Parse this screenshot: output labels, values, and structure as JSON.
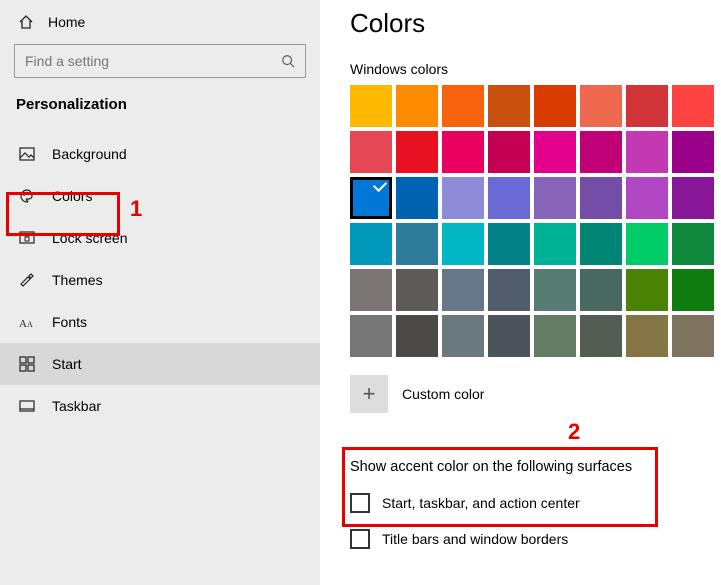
{
  "sidebar": {
    "home_label": "Home",
    "search_placeholder": "Find a setting",
    "category_label": "Personalization",
    "items": [
      {
        "label": "Background"
      },
      {
        "label": "Colors"
      },
      {
        "label": "Lock screen"
      },
      {
        "label": "Themes"
      },
      {
        "label": "Fonts"
      },
      {
        "label": "Start"
      },
      {
        "label": "Taskbar"
      }
    ]
  },
  "content": {
    "title": "Colors",
    "windows_colors_label": "Windows colors",
    "selected_index": 16,
    "colors": [
      "#ffb900",
      "#ff8c00",
      "#f7630c",
      "#ca5010",
      "#da3b01",
      "#ef6950",
      "#d13438",
      "#ff4343",
      "#e74856",
      "#e81123",
      "#ea005e",
      "#c30052",
      "#e3008c",
      "#bf0077",
      "#c239b3",
      "#9a0089",
      "#0078d7",
      "#0063b1",
      "#8e8cd8",
      "#6b69d6",
      "#8764b8",
      "#744da9",
      "#b146c2",
      "#881798",
      "#0099bc",
      "#2d7d9a",
      "#00b7c3",
      "#038387",
      "#00b294",
      "#018574",
      "#00cc6a",
      "#10893e",
      "#7a7574",
      "#5d5a58",
      "#68768a",
      "#515c6b",
      "#567c73",
      "#486860",
      "#498205",
      "#107c10",
      "#767676",
      "#4c4a48",
      "#69797e",
      "#4a5459",
      "#647c64",
      "#525e54",
      "#847545",
      "#7e735f"
    ],
    "custom_color_label": "Custom color",
    "accent_section_heading": "Show accent color on the following surfaces",
    "check_start_label": "Start, taskbar, and action center",
    "check_title_label": "Title bars and window borders"
  },
  "annotations": {
    "one": "1",
    "two": "2"
  }
}
